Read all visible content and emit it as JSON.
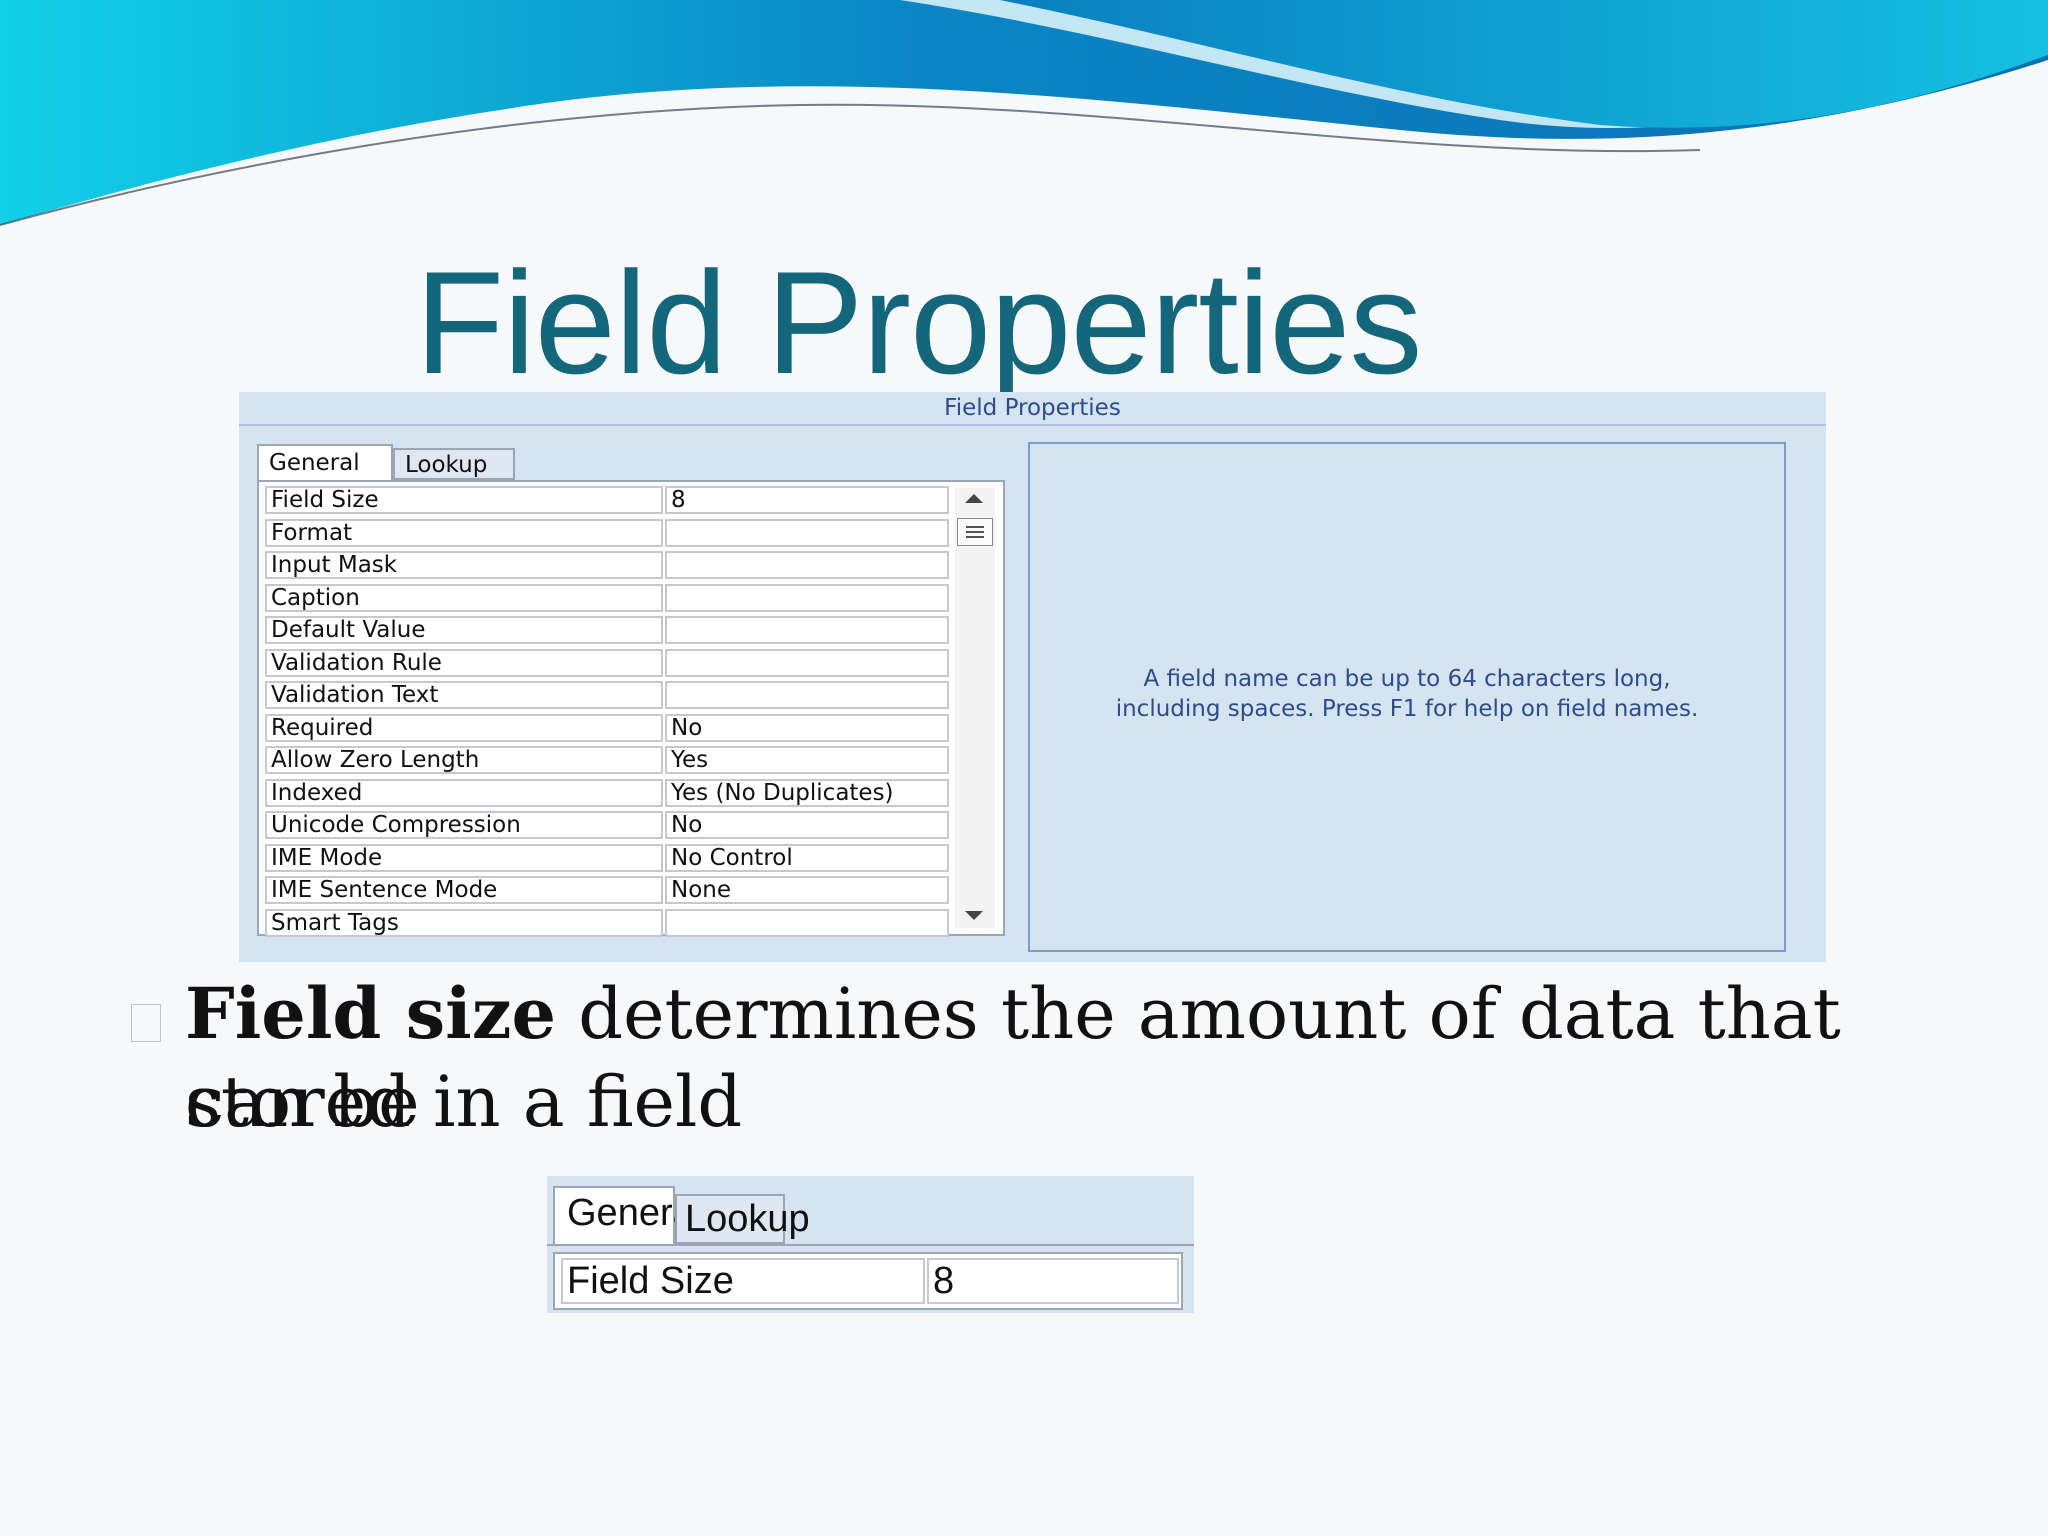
{
  "slide": {
    "title": "Field Properties",
    "colors": {
      "title": "#14667a",
      "wave_dark": "#0a7fbf",
      "wave_light": "#19c4e4"
    }
  },
  "panel": {
    "header": "Field Properties",
    "tabs": [
      {
        "label": "General",
        "active": true
      },
      {
        "label": "Lookup",
        "active": false
      }
    ],
    "properties": [
      {
        "name": "Field Size",
        "value": "8"
      },
      {
        "name": "Format",
        "value": ""
      },
      {
        "name": "Input Mask",
        "value": ""
      },
      {
        "name": "Caption",
        "value": ""
      },
      {
        "name": "Default Value",
        "value": ""
      },
      {
        "name": "Validation Rule",
        "value": ""
      },
      {
        "name": "Validation Text",
        "value": ""
      },
      {
        "name": "Required",
        "value": "No"
      },
      {
        "name": "Allow Zero Length",
        "value": "Yes"
      },
      {
        "name": "Indexed",
        "value": "Yes (No Duplicates)"
      },
      {
        "name": "Unicode Compression",
        "value": "No"
      },
      {
        "name": "IME Mode",
        "value": "No Control"
      },
      {
        "name": "IME Sentence Mode",
        "value": "None"
      },
      {
        "name": "Smart Tags",
        "value": ""
      }
    ],
    "help_text": "A field name can be up to 64 characters long,\nincluding spaces.  Press F1 for help on field names."
  },
  "bullet": {
    "lead": "Field size",
    "rest": " determines the amount of data that can be",
    "line2": "stored in a field"
  },
  "zoom": {
    "tab_general": "General",
    "tab_lookup": "Lookup",
    "field_name": "Field Size",
    "field_value": "8"
  }
}
